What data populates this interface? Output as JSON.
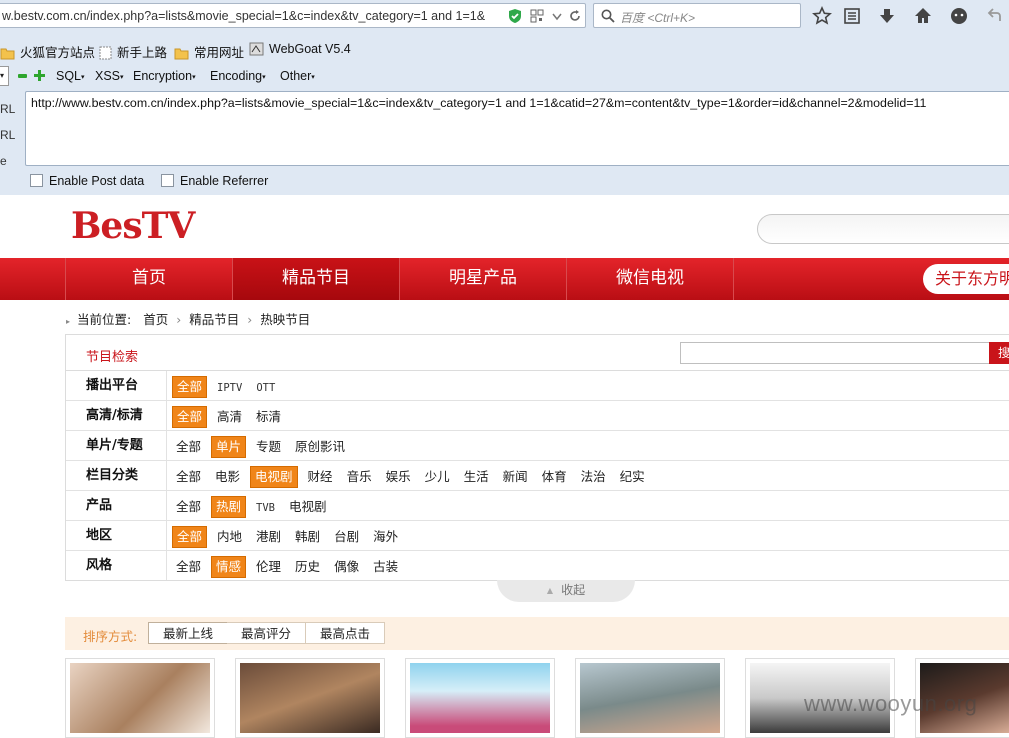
{
  "browser": {
    "url_display": "w.bestv.com.cn/index.php?a=lists&movie_special=1&c=index&tv_category=1 and 1=1&",
    "search_placeholder": "百度 <Ctrl+K>"
  },
  "bookmarks": [
    {
      "label": "火狐官方站点",
      "icon": "folder-icon"
    },
    {
      "label": "新手上路",
      "icon": "page-icon"
    },
    {
      "label": "常用网址",
      "icon": "folder-icon"
    },
    {
      "label": "WebGoat V5.4",
      "icon": "webgoat-icon"
    }
  ],
  "hackbar": {
    "menu": [
      "SQL",
      "XSS",
      "Encryption",
      "Encoding",
      "Other"
    ],
    "side_labels": [
      "RL",
      "RL",
      "e"
    ],
    "url_value": "http://www.bestv.com.cn/index.php?a=lists&movie_special=1&c=index&tv_category=1 and 1=1&catid=27&m=content&tv_type=1&order=id&channel=2&modelid=11",
    "enable_post": "Enable Post data",
    "enable_referrer": "Enable Referrer"
  },
  "site": {
    "logo": "BesTV",
    "nav": [
      {
        "label": "首页",
        "active": false
      },
      {
        "label": "精品节目",
        "active": true
      },
      {
        "label": "明星产品",
        "active": false
      },
      {
        "label": "微信电视",
        "active": false
      }
    ],
    "nav_about": "关于东方明",
    "breadcrumb": {
      "prefix": "当前位置:",
      "items": [
        "首页",
        "精品节目",
        "热映节目"
      ]
    },
    "filter": {
      "title": "节目检索",
      "search_button": "搜",
      "rows": [
        {
          "label": "播出平台",
          "options": [
            "全部",
            "IPTV",
            "OTT"
          ],
          "selected": 0
        },
        {
          "label": "高清/标清",
          "options": [
            "全部",
            "高清",
            "标清"
          ],
          "selected": 0
        },
        {
          "label": "单片/专题",
          "options": [
            "全部",
            "单片",
            "专题",
            "原创影讯"
          ],
          "selected": 1
        },
        {
          "label": "栏目分类",
          "options": [
            "全部",
            "电影",
            "电视剧",
            "财经",
            "音乐",
            "娱乐",
            "少儿",
            "生活",
            "新闻",
            "体育",
            "法治",
            "纪实"
          ],
          "selected": 2
        },
        {
          "label": "产品",
          "options": [
            "全部",
            "热剧",
            "TVB",
            "电视剧"
          ],
          "selected": 1
        },
        {
          "label": "地区",
          "options": [
            "全部",
            "内地",
            "港剧",
            "韩剧",
            "台剧",
            "海外"
          ],
          "selected": 0
        },
        {
          "label": "风格",
          "options": [
            "全部",
            "情感",
            "伦理",
            "历史",
            "偶像",
            "古装"
          ],
          "selected": 1
        }
      ],
      "collapse": "收起"
    },
    "sort": {
      "label": "排序方式:",
      "options": [
        "最新上线",
        "最高评分",
        "最高点击"
      ],
      "selected": 0
    },
    "watermark": "www.wooyun.org"
  },
  "colors": {
    "brand_red": "#cc1f24",
    "select_orange": "#f08519"
  }
}
